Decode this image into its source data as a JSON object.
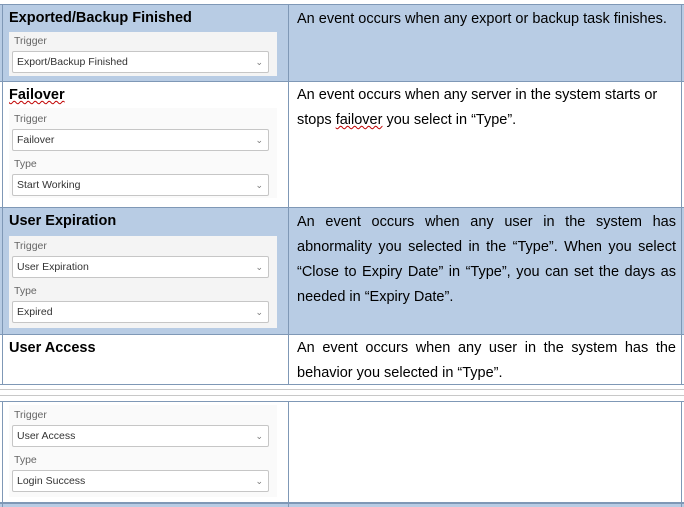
{
  "rows": [
    {
      "title": "Exported/Backup Finished",
      "description": "An event occurs when any export or backup task finishes.",
      "fields": [
        {
          "label": "Trigger",
          "value": "Export/Backup Finished"
        }
      ]
    },
    {
      "title": "Failover",
      "description_parts": [
        "An event occurs when any server in the system starts or stops ",
        "failover",
        " you select in “Type”."
      ],
      "fields": [
        {
          "label": "Trigger",
          "value": "Failover"
        },
        {
          "label": "Type",
          "value": "Start Working"
        }
      ]
    },
    {
      "title": "User Expiration",
      "description": "An event occurs when any user in the system has abnormality you selected in the “Type”. When you select “Close to Expiry Date” in “Type”, you can set the days as needed in “Expiry Date”.",
      "fields": [
        {
          "label": "Trigger",
          "value": "User Expiration"
        },
        {
          "label": "Type",
          "value": "Expired"
        }
      ]
    },
    {
      "title": "User Access",
      "description": "An event occurs when any user in the system has the behavior you selected in “Type”.",
      "fields": [
        {
          "label": "Trigger",
          "value": "User Access"
        },
        {
          "label": "Type",
          "value": "Login Success"
        }
      ]
    }
  ],
  "colors": {
    "band": "#b8cce4",
    "border": "#7f98b6",
    "misspell": "#c00000"
  },
  "icons": {
    "select_arrow": "chevron-down-icon"
  }
}
